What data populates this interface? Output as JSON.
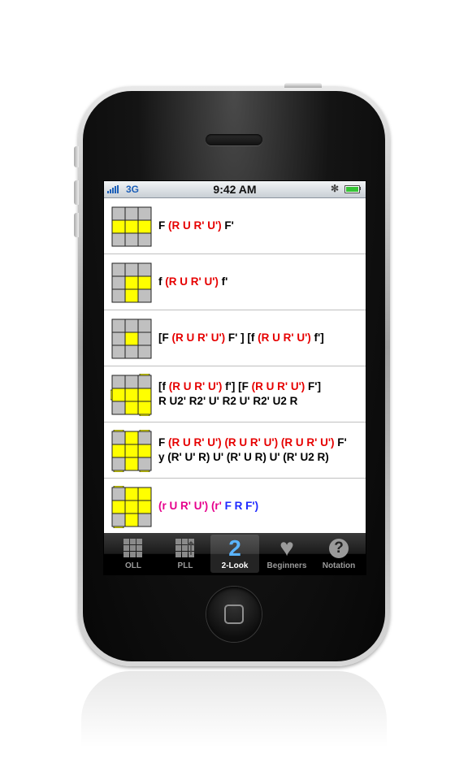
{
  "status_bar": {
    "carrier": "3G",
    "time": "9:42 AM",
    "bluetooth_glyph": "✻"
  },
  "colors": {
    "yellow": "#ffff00",
    "gray": "#c0c0c0",
    "red": "#e60000",
    "magenta": "#e6008c",
    "blue": "#1e29ff"
  },
  "algorithms": [
    {
      "pattern": [
        "g",
        "g",
        "g",
        "y",
        "y",
        "y",
        "g",
        "g",
        "g"
      ],
      "side_bars": [],
      "lines": [
        [
          [
            "black",
            "F "
          ],
          [
            "red",
            "(R U R' U')"
          ],
          [
            "black",
            " F'"
          ]
        ]
      ]
    },
    {
      "pattern": [
        "g",
        "g",
        "g",
        "g",
        "y",
        "y",
        "g",
        "y",
        "g"
      ],
      "side_bars": [],
      "lines": [
        [
          [
            "black",
            "f "
          ],
          [
            "red",
            "(R U R' U')"
          ],
          [
            "black",
            " f'"
          ]
        ]
      ]
    },
    {
      "pattern": [
        "g",
        "g",
        "g",
        "g",
        "y",
        "g",
        "g",
        "g",
        "g"
      ],
      "side_bars": [],
      "lines": [
        [
          [
            "black",
            "[F "
          ],
          [
            "red",
            "(R U R' U')"
          ],
          [
            "black",
            " F' ] [f "
          ],
          [
            "red",
            "(R U R' U')"
          ],
          [
            "black",
            " f']"
          ]
        ]
      ]
    },
    {
      "pattern": [
        "g",
        "g",
        "g",
        "y",
        "y",
        "y",
        "g",
        "y",
        "y"
      ],
      "side_bars": [
        "top-right",
        "left-middle",
        "bottom-right"
      ],
      "lines": [
        [
          [
            "black",
            "[f "
          ],
          [
            "red",
            "(R U R' U')"
          ],
          [
            "black",
            " f'] [F "
          ],
          [
            "red",
            "(R U R' U')"
          ],
          [
            "black",
            " F']"
          ]
        ],
        [
          [
            "black",
            "R U2' R2' U' R2 U' R2' U2 R"
          ]
        ]
      ]
    },
    {
      "pattern": [
        "g",
        "y",
        "g",
        "y",
        "y",
        "y",
        "g",
        "y",
        "g"
      ],
      "side_bars": [
        "top-left",
        "top-right",
        "bottom-left",
        "bottom-right"
      ],
      "lines": [
        [
          [
            "black",
            "F "
          ],
          [
            "red",
            "(R U R' U')"
          ],
          [
            "black",
            " "
          ],
          [
            "red",
            "(R U R' U')"
          ],
          [
            "black",
            " "
          ],
          [
            "red",
            "(R U R' U')"
          ],
          [
            "black",
            " F'"
          ]
        ],
        [
          [
            "black",
            "y (R' U' R) U' (R' U R) U' (R' U2 R)"
          ]
        ]
      ]
    },
    {
      "pattern": [
        "g",
        "y",
        "y",
        "y",
        "y",
        "y",
        "g",
        "y",
        "g"
      ],
      "side_bars": [
        "top-left",
        "bottom-left"
      ],
      "lines": [
        [
          [
            "magenta",
            "(r U R' U')"
          ],
          [
            "black",
            " "
          ],
          [
            "magenta",
            "(r'"
          ],
          [
            "blue",
            " F R F')"
          ]
        ]
      ]
    }
  ],
  "tabs": [
    {
      "label": "OLL",
      "icon": "grid-icon",
      "selected": false
    },
    {
      "label": "PLL",
      "icon": "pll-grid-icon",
      "selected": false
    },
    {
      "label": "2-Look",
      "icon": "two-icon",
      "glyph": "2",
      "selected": true
    },
    {
      "label": "Beginners",
      "icon": "heart-icon",
      "glyph": "♥",
      "selected": false
    },
    {
      "label": "Notation",
      "icon": "question-icon",
      "glyph": "?",
      "selected": false
    }
  ]
}
